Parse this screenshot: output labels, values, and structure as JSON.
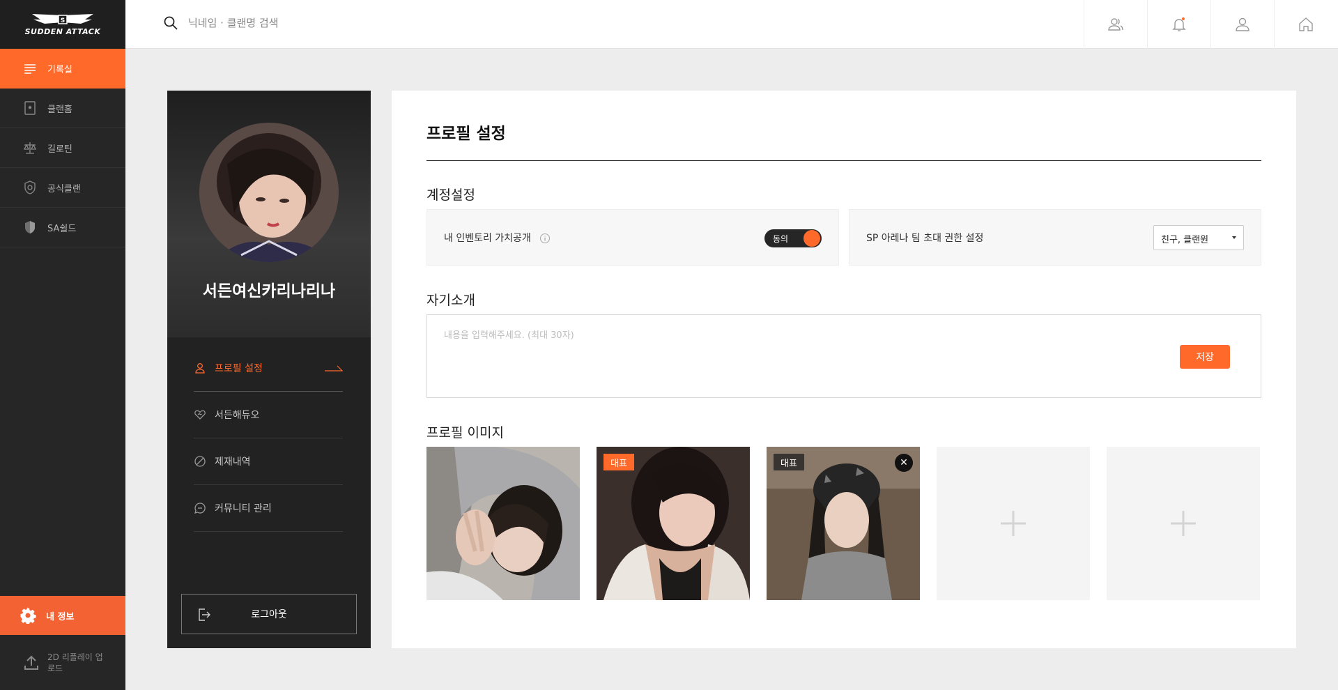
{
  "brand": {
    "logo_text": "SUDDEN ATTACK"
  },
  "nav": {
    "items": [
      {
        "label": "기록실",
        "icon": "list-icon",
        "active": true
      },
      {
        "label": "클랜홈",
        "icon": "clan-book-icon",
        "active": false
      },
      {
        "label": "길로틴",
        "icon": "scale-icon",
        "active": false
      },
      {
        "label": "공식클랜",
        "icon": "official-badge-icon",
        "active": false
      },
      {
        "label": "SA쉴드",
        "icon": "shield-icon",
        "active": false
      }
    ],
    "my_info": "내 정보",
    "replay_upload": "2D 리플레이 업로드"
  },
  "topbar": {
    "search_placeholder": "닉네임 · 클랜명 검색",
    "icons": [
      "friends-icon",
      "notification-bell-icon",
      "user-icon",
      "home-icon"
    ],
    "notification_dot_color": "#ff6a2b"
  },
  "profile": {
    "nickname": "서든여신카리나리나",
    "menu": [
      {
        "label": "프로필 설정",
        "icon": "user-icon",
        "active": true
      },
      {
        "label": "서든해듀오",
        "icon": "heart-handshake-icon",
        "active": false
      },
      {
        "label": "제재내역",
        "icon": "ban-icon",
        "active": false
      },
      {
        "label": "커뮤니티 관리",
        "icon": "chat-icon",
        "active": false
      }
    ],
    "logout": "로그아웃"
  },
  "settings": {
    "page_title": "프로필 설정",
    "account_section": "계정설정",
    "inventory_label": "내 인벤토리 가치공개",
    "inventory_toggle": "동의",
    "inventory_toggle_on": true,
    "invite_label": "SP 아레나 팀 초대 권한 설정",
    "invite_value": "친구, 클랜원",
    "intro_section": "자기소개",
    "intro_placeholder": "내용을 입력해주세요. (최대 30자)",
    "intro_value": "",
    "save_label": "저장",
    "image_section": "프로필 이미지",
    "images": [
      {
        "badge": ""
      },
      {
        "badge": "대표"
      },
      {
        "badge": "대표",
        "removable": true
      },
      {
        "empty": true
      },
      {
        "empty": true
      }
    ]
  },
  "colors": {
    "accent": "#ff6a2b",
    "nav_bg": "#262626"
  }
}
